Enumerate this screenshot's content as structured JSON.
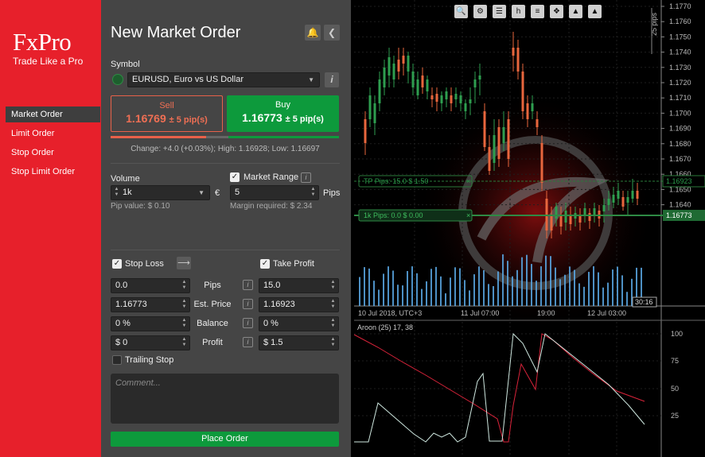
{
  "brand": {
    "name": "FxPro",
    "tagline": "Trade Like a Pro"
  },
  "nav": [
    {
      "label": "Market Order",
      "active": true
    },
    {
      "label": "Limit Order",
      "active": false
    },
    {
      "label": "Stop Order",
      "active": false
    },
    {
      "label": "Stop Limit Order",
      "active": false
    }
  ],
  "order": {
    "title": "New Market Order",
    "symbol_label": "Symbol",
    "symbol_value": "EURUSD, Euro vs US Dollar",
    "sell": {
      "label": "Sell",
      "price": "1.16769",
      "spread": "± 5 pip(s)"
    },
    "buy": {
      "label": "Buy",
      "price": "1.16773",
      "spread": "± 5 pip(s)"
    },
    "change_text": "Change: +4.0 (+0.03%); High: 1.16928; Low: 1.16697",
    "volume_label": "Volume",
    "volume_value": "1k",
    "currency": "€",
    "pip_value": "Pip value: $ 0.10",
    "market_range_label": "Market Range",
    "market_range_value": "5",
    "pips_unit": "Pips",
    "margin_required": "Margin required: $ 2.34",
    "stop_loss_label": "Stop Loss",
    "take_profit_label": "Take Profit",
    "rows": [
      {
        "label": "Pips",
        "sl": "0.0",
        "tp": "15.0"
      },
      {
        "label": "Est. Price",
        "sl": "1.16773",
        "tp": "1.16923"
      },
      {
        "label": "Balance",
        "sl": "0 %",
        "tp": "0 %"
      },
      {
        "label": "Profit",
        "sl": "$ 0",
        "tp": "$ 1.5"
      }
    ],
    "trailing_stop_label": "Trailing Stop",
    "comment_placeholder": "Comment...",
    "place_order_label": "Place Order"
  },
  "chart": {
    "price_ticks": [
      "1.1770",
      "1.1760",
      "1.1750",
      "1.1740",
      "1.1730",
      "1.1720",
      "1.1710",
      "1.1700",
      "1.1690",
      "1.1680",
      "1.1670",
      "1.1660",
      "1.1650",
      "1.1640"
    ],
    "time_ticks": [
      "10 Jul 2018, UTC+3",
      "11 Jul 07:00",
      "19:00",
      "12 Jul 03:00"
    ],
    "pips_scale_label": "25 pips",
    "tp_line": {
      "label": "TP",
      "pips": "Pips: 15.0",
      "amount": "$ 1.50",
      "price": "1.16923"
    },
    "entry_line": {
      "label": "1k",
      "pips": "Pips: 0.0",
      "amount": "$ 0.00",
      "price": "1.16773"
    },
    "countdown": "30:16",
    "aroon_label": "Aroon (25) 17, 38",
    "aroon_ticks": [
      "100",
      "75",
      "50",
      "25"
    ],
    "colors": {
      "up": "#2e9e4f",
      "down": "#e8663d",
      "volume": "#5aa9e6",
      "aroon_up": "#cfe8e0",
      "aroon_down": "#d9233a",
      "tp_line": "#2a7a3a"
    }
  }
}
